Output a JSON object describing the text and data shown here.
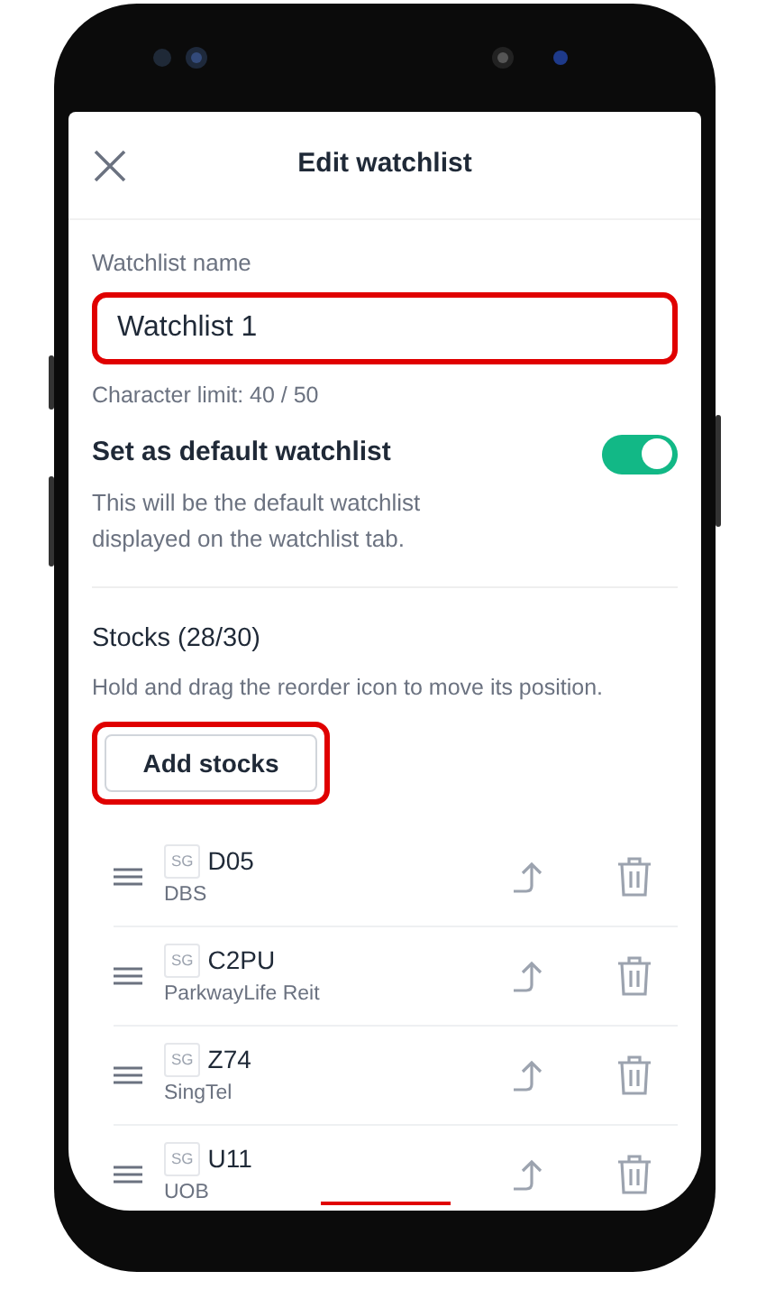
{
  "header": {
    "title": "Edit watchlist"
  },
  "name_field": {
    "label": "Watchlist name",
    "value": "Watchlist 1",
    "highlighted": true,
    "hint": "Character limit: 40 / 50"
  },
  "default_setting": {
    "title": "Set as default watchlist",
    "description": "This will be the default watchlist displayed on the watchlist tab.",
    "on": true
  },
  "stocks": {
    "title": "Stocks (28/30)",
    "hint": "Hold and drag the reorder icon to move its position.",
    "add_button": {
      "label": "Add stocks",
      "highlighted": true
    },
    "items": [
      {
        "market": "SG",
        "code": "D05",
        "name": "DBS"
      },
      {
        "market": "SG",
        "code": "C2PU",
        "name": "ParkwayLife Reit"
      },
      {
        "market": "SG",
        "code": "Z74",
        "name": "SingTel"
      },
      {
        "market": "SG",
        "code": "U11",
        "name": "UOB"
      }
    ]
  }
}
